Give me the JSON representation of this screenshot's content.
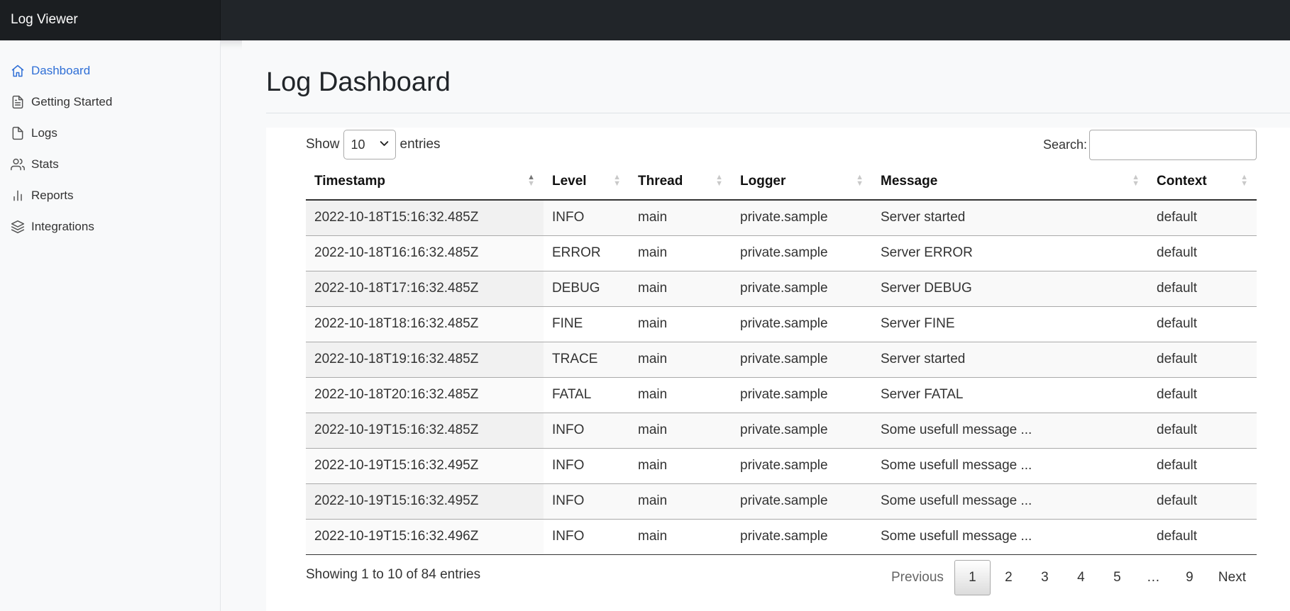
{
  "app": {
    "brand": "Log Viewer"
  },
  "sidebar": {
    "items": [
      {
        "label": "Dashboard",
        "icon": "home-icon",
        "active": true
      },
      {
        "label": "Getting Started",
        "icon": "file-text-icon"
      },
      {
        "label": "Logs",
        "icon": "file-icon"
      },
      {
        "label": "Stats",
        "icon": "users-icon"
      },
      {
        "label": "Reports",
        "icon": "bar-chart-icon"
      },
      {
        "label": "Integrations",
        "icon": "layers-icon"
      }
    ]
  },
  "page": {
    "title": "Log Dashboard"
  },
  "table_controls": {
    "show_label": "Show",
    "page_size": "10",
    "entries_label": "entries",
    "search_label": "Search:",
    "search_value": ""
  },
  "table": {
    "columns": [
      "Timestamp",
      "Level",
      "Thread",
      "Logger",
      "Message",
      "Context"
    ],
    "rows": [
      [
        "2022-10-18T15:16:32.485Z",
        "INFO",
        "main",
        "private.sample",
        "Server started",
        "default"
      ],
      [
        "2022-10-18T16:16:32.485Z",
        "ERROR",
        "main",
        "private.sample",
        "Server ERROR",
        "default"
      ],
      [
        "2022-10-18T17:16:32.485Z",
        "DEBUG",
        "main",
        "private.sample",
        "Server DEBUG",
        "default"
      ],
      [
        "2022-10-18T18:16:32.485Z",
        "FINE",
        "main",
        "private.sample",
        "Server FINE",
        "default"
      ],
      [
        "2022-10-18T19:16:32.485Z",
        "TRACE",
        "main",
        "private.sample",
        "Server started",
        "default"
      ],
      [
        "2022-10-18T20:16:32.485Z",
        "FATAL",
        "main",
        "private.sample",
        "Server FATAL",
        "default"
      ],
      [
        "2022-10-19T15:16:32.485Z",
        "INFO",
        "main",
        "private.sample",
        "Some usefull message ...",
        "default"
      ],
      [
        "2022-10-19T15:16:32.495Z",
        "INFO",
        "main",
        "private.sample",
        "Some usefull message ...",
        "default"
      ],
      [
        "2022-10-19T15:16:32.495Z",
        "INFO",
        "main",
        "private.sample",
        "Some usefull message ...",
        "default"
      ],
      [
        "2022-10-19T15:16:32.496Z",
        "INFO",
        "main",
        "private.sample",
        "Some usefull message ...",
        "default"
      ]
    ]
  },
  "footer": {
    "info": "Showing 1 to 10 of 84 entries",
    "previous": "Previous",
    "next": "Next",
    "pages": [
      "1",
      "2",
      "3",
      "4",
      "5",
      "…",
      "9"
    ],
    "current_page": "1"
  },
  "colors": {
    "topbar": "#212529",
    "active_link": "#2f6fd6"
  }
}
